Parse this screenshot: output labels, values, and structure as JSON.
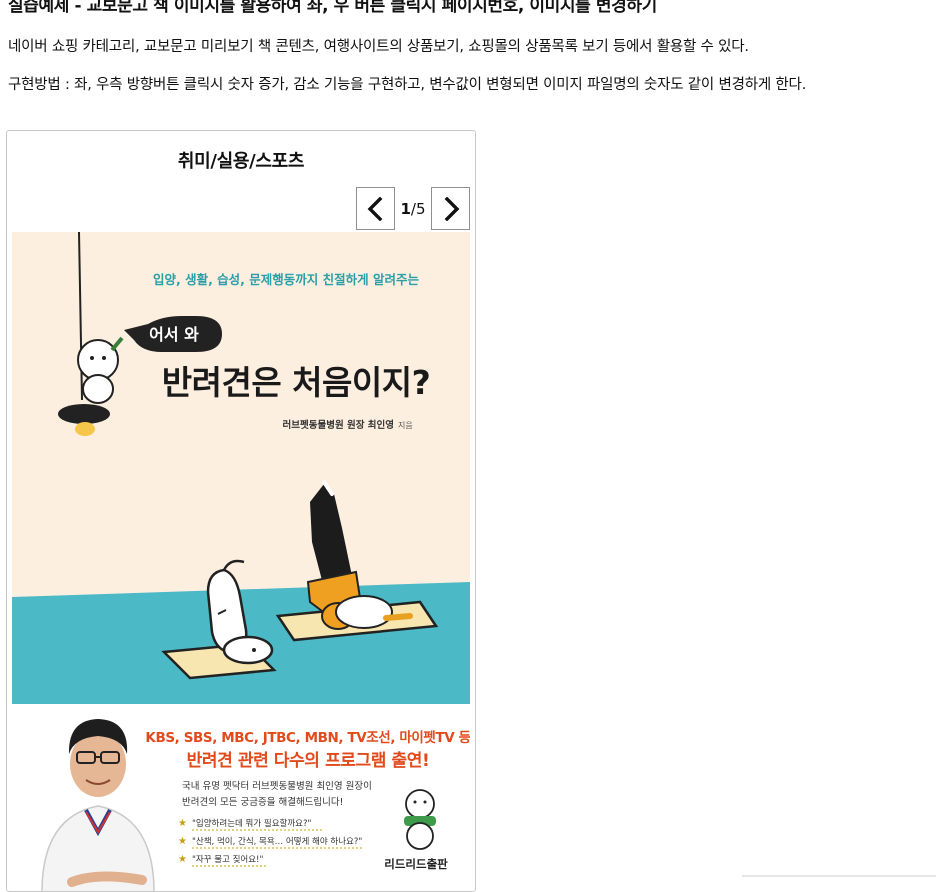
{
  "header": {
    "title": "실습예제 - 교보문고 책 이미지를 활용하여 좌, 우 버튼 클릭시 페이지번호, 이미지를 변경하기"
  },
  "paragraphs": {
    "usage": "네이버 쇼핑 카테고리, 교보문고 미리보기 책 콘텐츠, 여행사이트의 상품보기, 쇼핑몰의 상품목록 보기 등에서 활용할 수 있다.",
    "method": "구현방법 : 좌, 우측 방향버튼 클릭시 숫자 증가, 감소 기능을 구현하고, 변수값이 변형되면 이미지 파일명의 숫자도 같이 변경하게 한다."
  },
  "widget": {
    "category": "취미/실용/스포츠",
    "current_page": "1",
    "total_pages": "/5",
    "prev_icon": "chevron-left-icon",
    "next_icon": "chevron-right-icon"
  },
  "book": {
    "tagline": "입양, 생활, 습성, 문제행동까지 친절하게 알려주는",
    "bubble": "어서 와",
    "title": "반려견은 처음이지?",
    "author": "러브펫동물병원 원장 최인영",
    "author_suffix": "지음",
    "promo_line1": "KBS, SBS, MBC, JTBC, MBN, TV조선, 마이펫TV 등",
    "promo_line2": "반려견 관련 다수의 프로그램 출연!",
    "blurb_line1": "국내 유명 펫닥터 러브펫동물병원 최인영 원장이",
    "blurb_line2": "반려견의 모든 궁금증을 해결해드립니다!",
    "quote1": "\"입양하려는데 뭐가 필요할까요?\"",
    "quote2": "\"산책, 먹이, 간식, 목욕… 어떻게 해야 하나요?\"",
    "quote3": "\"자꾸 물고 짖어요!\"",
    "publisher": "리드리드출판"
  },
  "colors": {
    "cover_bg": "#fcefe0",
    "floor": "#4bbac6",
    "tagline": "#2a9fa8",
    "promo": "#e24a1c",
    "accent_orange": "#f0a020"
  }
}
